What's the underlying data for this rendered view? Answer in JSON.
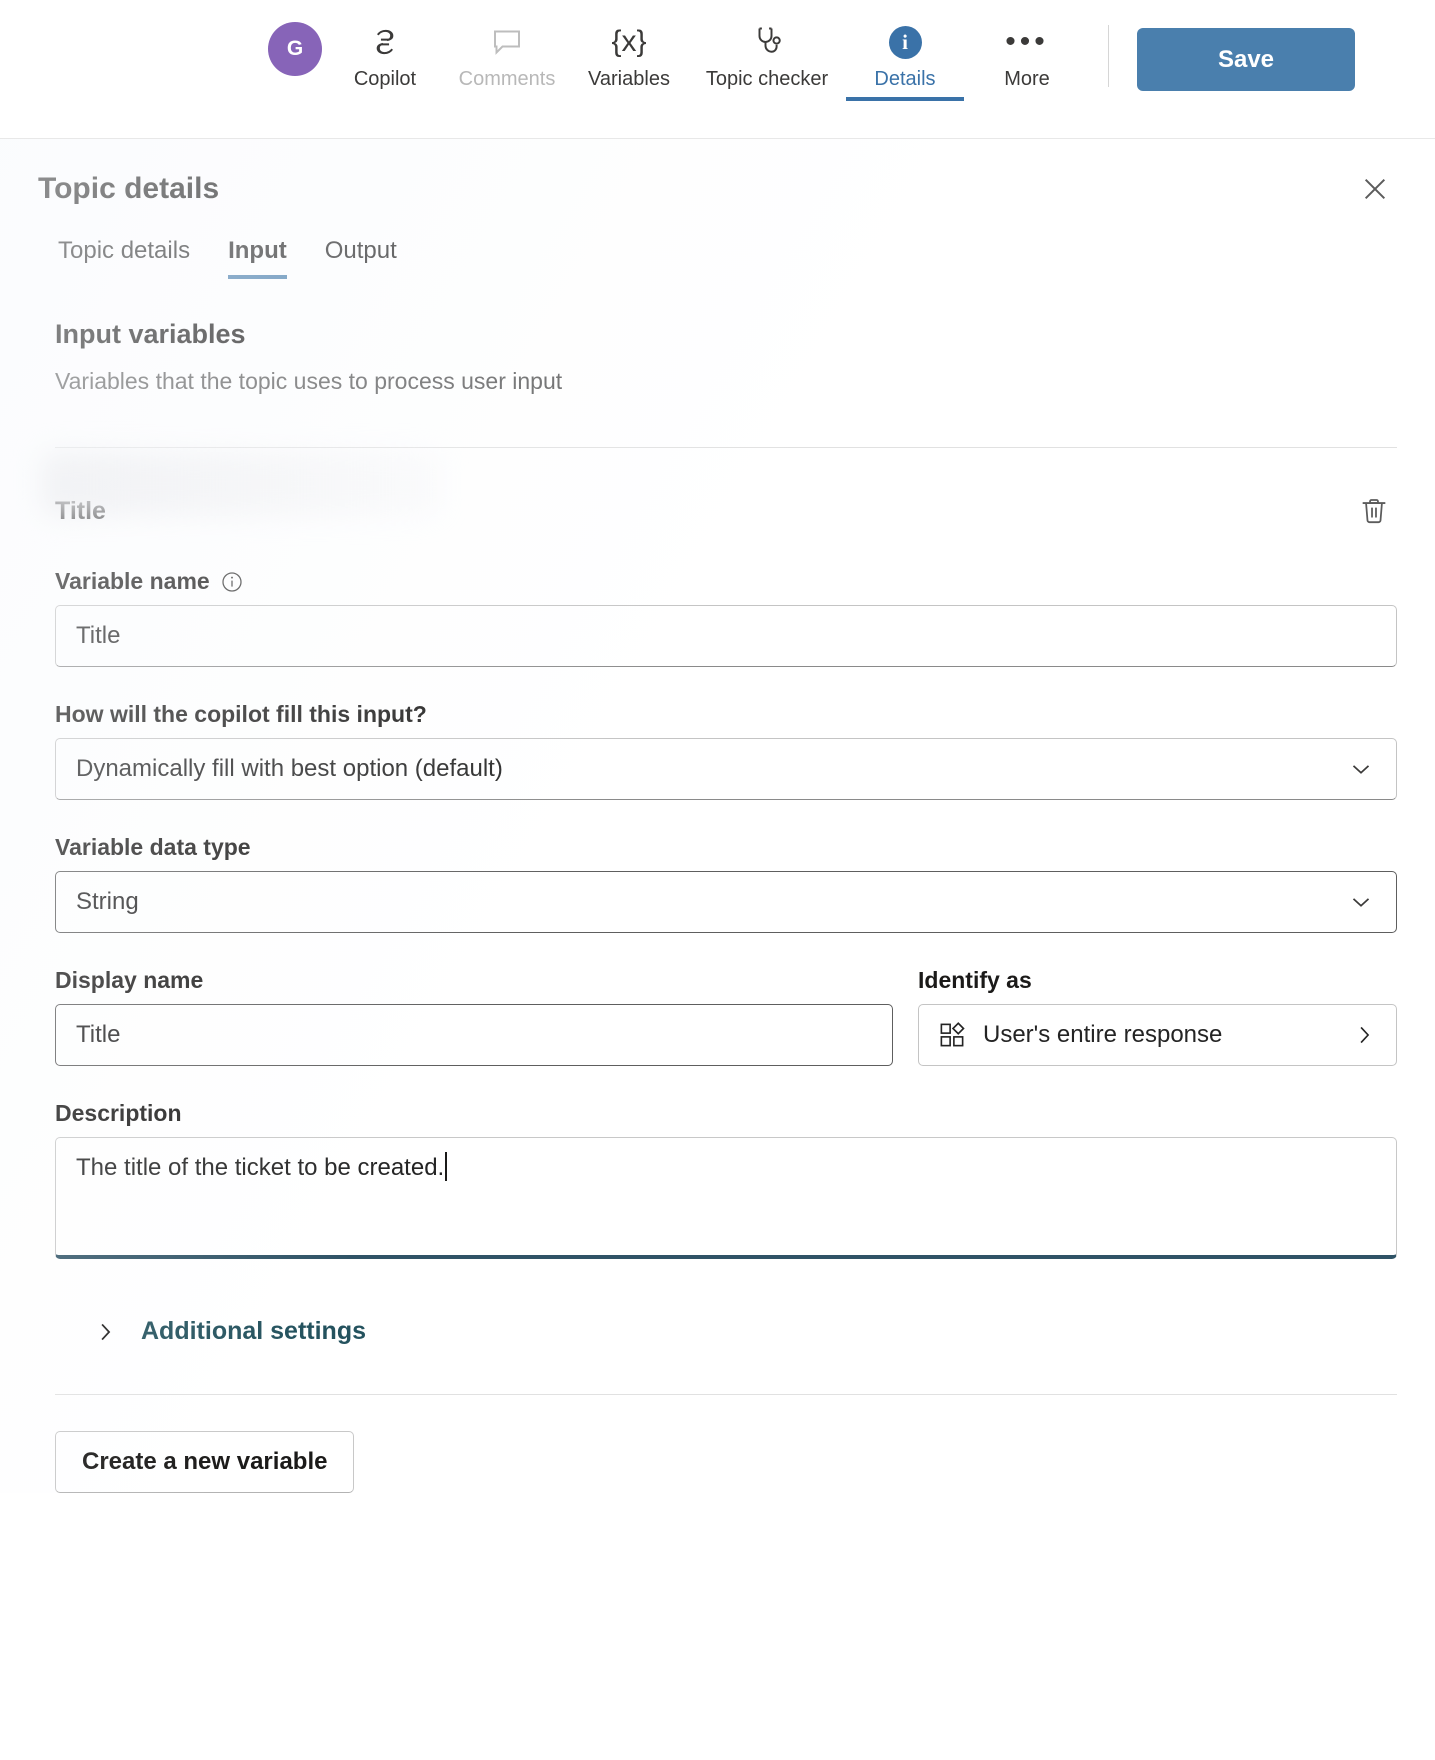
{
  "toolbar": {
    "avatar_initial": "G",
    "items": [
      {
        "label": "Copilot",
        "icon": "copilot-icon",
        "state": "normal"
      },
      {
        "label": "Comments",
        "icon": "comment-icon",
        "state": "disabled"
      },
      {
        "label": "Variables",
        "icon": "variables-icon",
        "state": "normal"
      },
      {
        "label": "Topic checker",
        "icon": "stethoscope-icon",
        "state": "normal"
      },
      {
        "label": "Details",
        "icon": "info-circle-icon",
        "state": "active"
      },
      {
        "label": "More",
        "icon": "ellipsis-icon",
        "state": "normal"
      }
    ],
    "variables_glyph": "{x}",
    "info_glyph": "i",
    "save_label": "Save",
    "accent_blue": "#4a7fad",
    "avatar_color": "#8764b8"
  },
  "panel": {
    "title": "Topic details",
    "close_icon": "close-icon",
    "tabs": [
      {
        "label": "Topic details",
        "active": false
      },
      {
        "label": "Input",
        "active": true
      },
      {
        "label": "Output",
        "active": false
      }
    ]
  },
  "input_variables": {
    "heading": "Input variables",
    "subtitle": "Variables that the topic uses to process user input"
  },
  "variable": {
    "heading": "Title",
    "delete_icon": "trash-icon",
    "variable_name": {
      "label": "Variable name",
      "info_icon": "info-icon",
      "value": "Title"
    },
    "fill_mode": {
      "label": "How will the copilot fill this input?",
      "value": "Dynamically fill with best option (default)",
      "chevron": "chevron-down-icon"
    },
    "data_type": {
      "label": "Variable data type",
      "value": "String",
      "chevron": "chevron-down-icon"
    },
    "display_name": {
      "label": "Display name",
      "value": "Title"
    },
    "identify_as": {
      "label": "Identify as",
      "value": "User's entire response",
      "icon": "entity-grid-icon",
      "chevron": "chevron-right-icon"
    },
    "description": {
      "label": "Description",
      "value": "The title of the ticket to be created."
    },
    "additional_settings": {
      "label": "Additional settings",
      "chevron": "chevron-right-icon",
      "color": "#24525e"
    }
  },
  "footer": {
    "create_variable_label": "Create a new variable"
  }
}
